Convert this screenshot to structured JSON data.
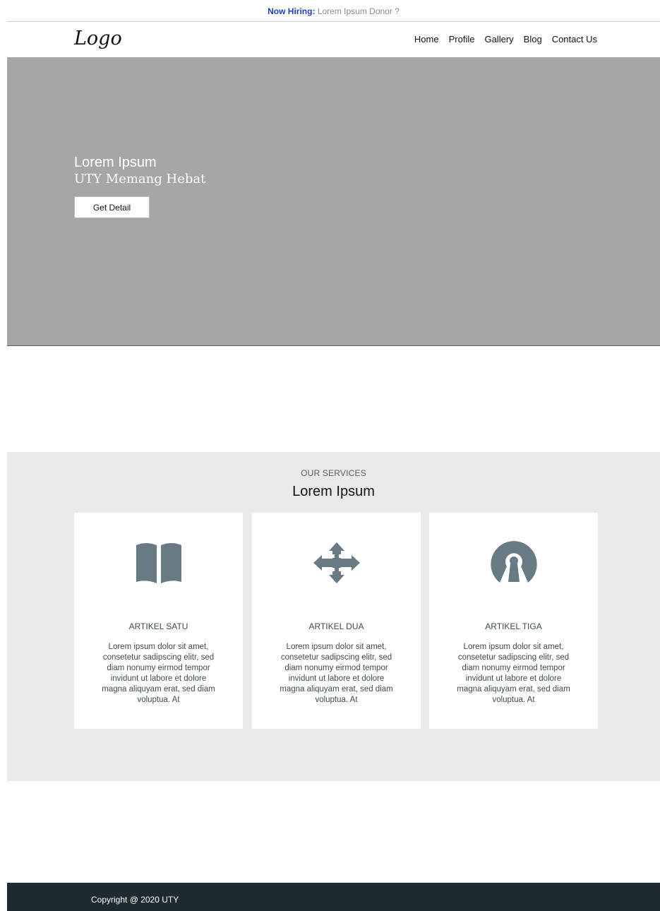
{
  "topbar": {
    "highlight": "Now Hiring:",
    "text": " Lorem Ipsum Donor ?"
  },
  "header": {
    "logo": "Logo",
    "nav": [
      "Home",
      "Profile",
      "Gallery",
      "Blog",
      "Contact Us"
    ]
  },
  "hero": {
    "title": "Lorem Ipsum",
    "subtitle": "UTY Memang Hebat",
    "button_label": "Get Detail"
  },
  "services": {
    "eyebrow": "OUR SERVICES",
    "title": "Lorem Ipsum",
    "cards": [
      {
        "icon": "book-icon",
        "title": "ARTIKEL SATU",
        "body": "Lorem ipsum dolor sit amet, consetetur sadipscing elitr, sed diam nonumy eirmod tempor invidunt ut labore et dolore magna aliquyam erat, sed diam voluptua. At"
      },
      {
        "icon": "move-arrows-icon",
        "title": "ARTIKEL DUA",
        "body": "Lorem ipsum dolor sit amet, consetetur sadipscing elitr, sed diam nonumy eirmod tempor invidunt ut labore et dolore magna aliquyam erat, sed diam voluptua. At"
      },
      {
        "icon": "open-source-icon",
        "title": "ARTIKEL TIGA",
        "body": "Lorem ipsum dolor sit amet, consetetur sadipscing elitr, sed diam nonumy eirmod tempor invidunt ut labore et dolore magna aliquyam erat, sed diam voluptua. At"
      }
    ]
  },
  "footer": {
    "copyright": "Copyright @ 2020 UTY"
  },
  "colors": {
    "hiring_highlight": "#1f3fb0",
    "hero_bg": "#a6a6a6",
    "services_bg": "#e9eaea",
    "icon": "#687b84",
    "footer_bg": "#1d2b31"
  }
}
